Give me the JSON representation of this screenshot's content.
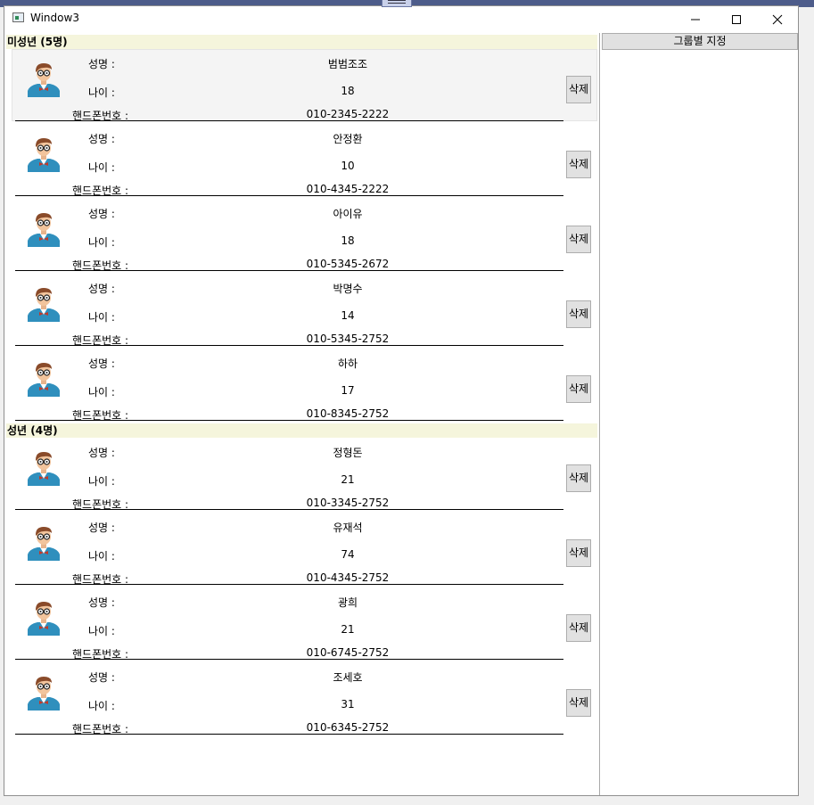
{
  "window": {
    "title": "Window3"
  },
  "right_panel": {
    "group_button_label": "그룹별 지정"
  },
  "labels": {
    "name": "성명 :",
    "age": "나이 :",
    "phone": "핸드폰번호 :",
    "delete": "삭제"
  },
  "groups": [
    {
      "header": "미성년 (5명)",
      "people": [
        {
          "name": "범범조조",
          "age": "18",
          "phone": "010-2345-2222",
          "selected": true
        },
        {
          "name": "안정환",
          "age": "10",
          "phone": "010-4345-2222"
        },
        {
          "name": "아이유",
          "age": "18",
          "phone": "010-5345-2672"
        },
        {
          "name": "박명수",
          "age": "14",
          "phone": "010-5345-2752"
        },
        {
          "name": "하하",
          "age": "17",
          "phone": "010-8345-2752"
        }
      ]
    },
    {
      "header": "성년 (4명)",
      "people": [
        {
          "name": "정형돈",
          "age": "21",
          "phone": "010-3345-2752"
        },
        {
          "name": "유재석",
          "age": "74",
          "phone": "010-4345-2752"
        },
        {
          "name": "광희",
          "age": "21",
          "phone": "010-6745-2752"
        },
        {
          "name": "조세호",
          "age": "31",
          "phone": "010-6345-2752"
        }
      ]
    }
  ],
  "icons": {
    "avatar": "person-avatar-icon",
    "minimize": "minimize-icon",
    "maximize": "maximize-icon",
    "close": "close-icon"
  },
  "colors": {
    "group_header_bg": "#f5f5dc",
    "button_bg": "#e1e1e1"
  }
}
